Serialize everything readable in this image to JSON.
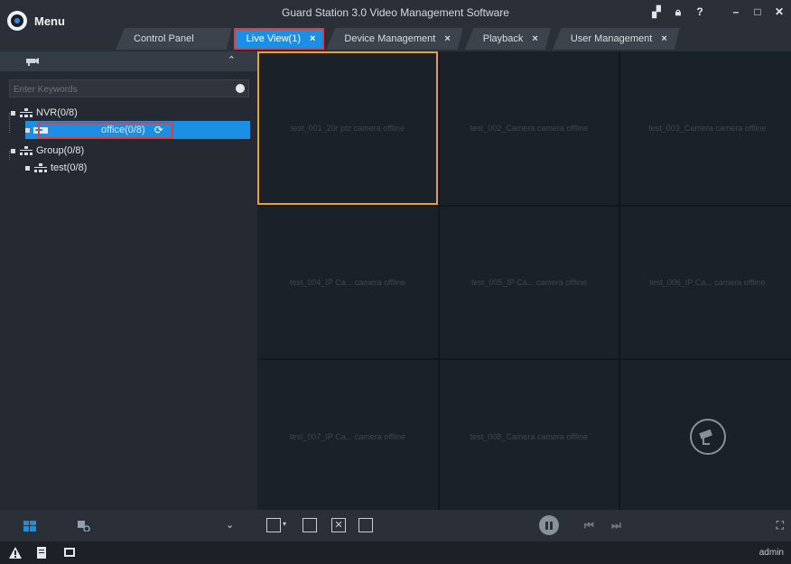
{
  "app": {
    "menu_label": "Menu",
    "title": "Guard Station 3.0 Video Management Software"
  },
  "tabs": [
    {
      "label": "Control Panel",
      "closable": false
    },
    {
      "label": "Live View(1)",
      "closable": true,
      "active": true
    },
    {
      "label": "Device Management",
      "closable": true
    },
    {
      "label": "Playback",
      "closable": true
    },
    {
      "label": "User Management",
      "closable": true
    }
  ],
  "tab_close_glyph": "×",
  "sidebar": {
    "search_placeholder": "Enter Keywords",
    "tree": {
      "nvr": "NVR(0/8)",
      "office": "office(0/8)",
      "group": "Group(0/8)",
      "test": "test(0/8)"
    }
  },
  "cells": [
    {
      "label": "test_001_20r ptz camera offline",
      "focused": true
    },
    {
      "label": "test_002_Camera camera offline"
    },
    {
      "label": "test_003_Camera camera offline"
    },
    {
      "label": "test_004_IP Ca... camera offline"
    },
    {
      "label": "test_005_IP Ca... camera offline"
    },
    {
      "label": "test_006_IP Ca... camera offline"
    },
    {
      "label": "test_007_IP Ca... camera offline"
    },
    {
      "label": "test_008_Camera camera offline"
    },
    {
      "label": "",
      "icon": "no-camera-icon"
    }
  ],
  "status": {
    "user": "admin"
  },
  "colors": {
    "accent": "#1a8fe3",
    "highlight_outline": "#e43b3b",
    "focus_cell": "#e8a42a"
  }
}
